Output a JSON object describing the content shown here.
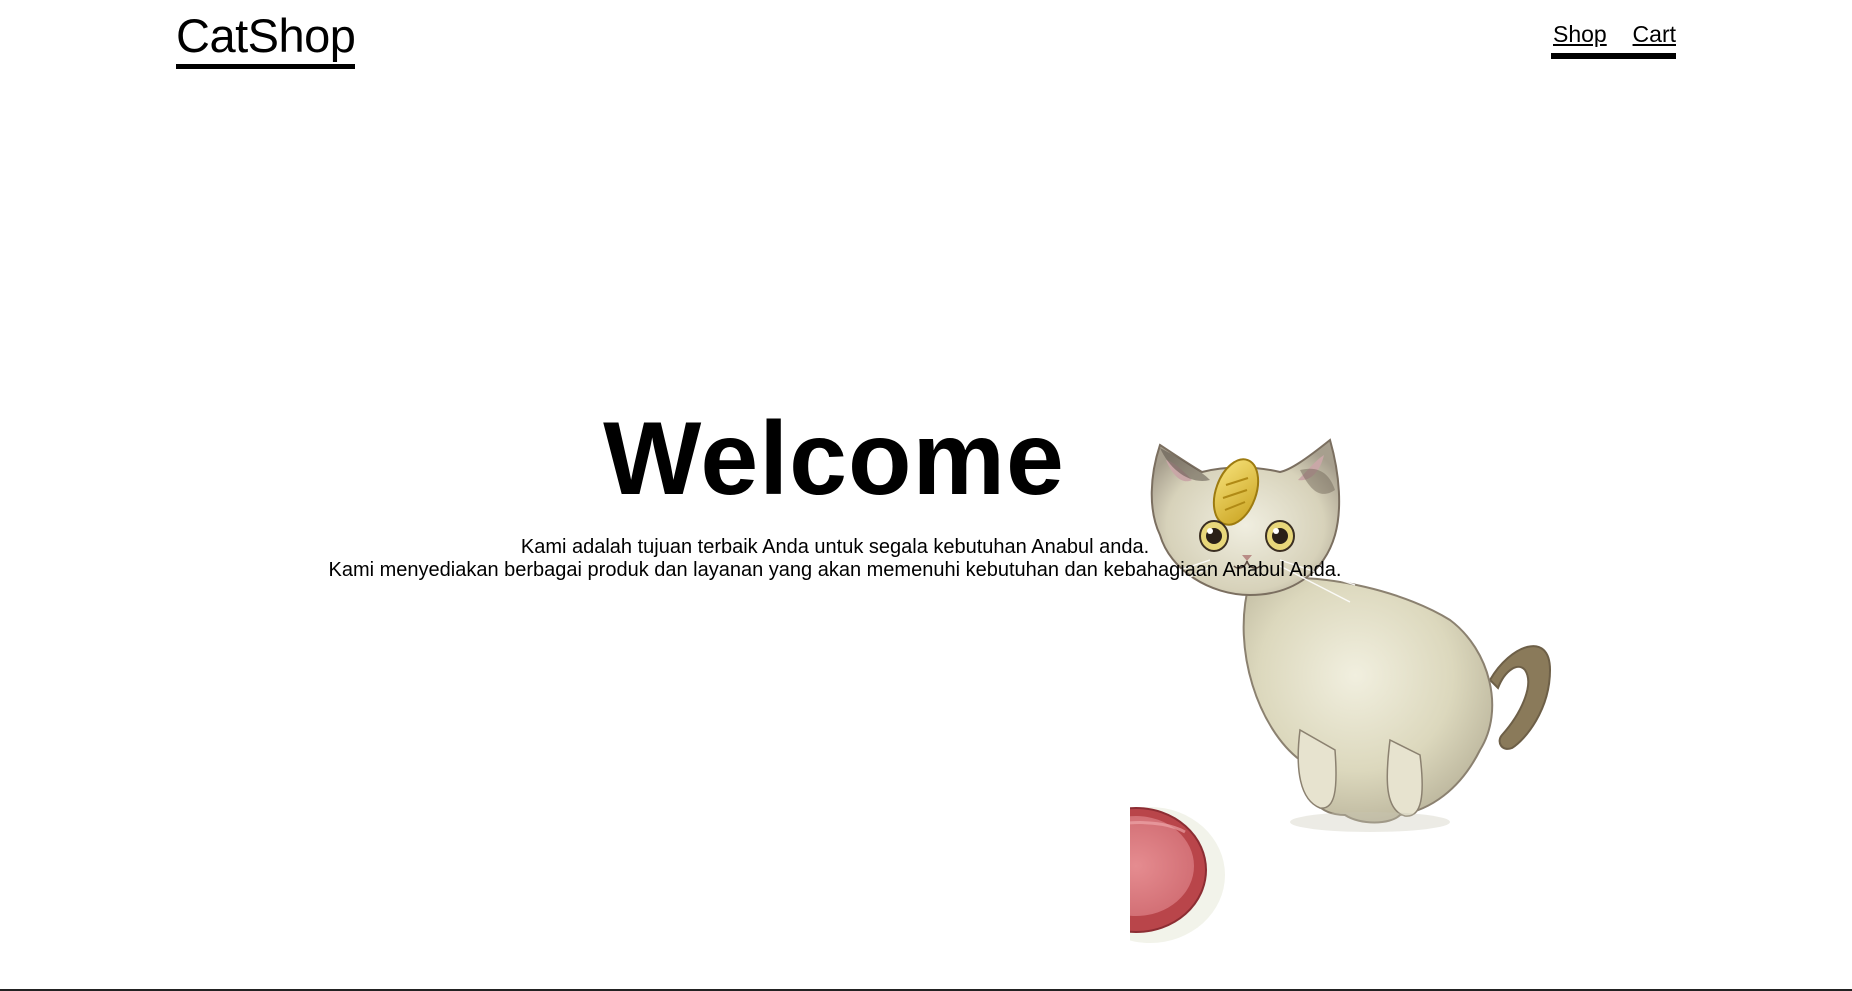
{
  "header": {
    "logo": "CatShop",
    "nav": [
      {
        "label": "Shop"
      },
      {
        "label": "Cart"
      }
    ]
  },
  "hero": {
    "title": "Welcome",
    "lines": [
      "Kami adalah tujuan terbaik Anda untuk segala kebutuhan Anabul anda.",
      "Kami menyediakan berbagai produk dan layanan yang akan memenuhi kebutuhan dan kebahagiaan Anabul Anda."
    ]
  },
  "illustration": {
    "icon": "cat-with-bowl-illustration"
  }
}
